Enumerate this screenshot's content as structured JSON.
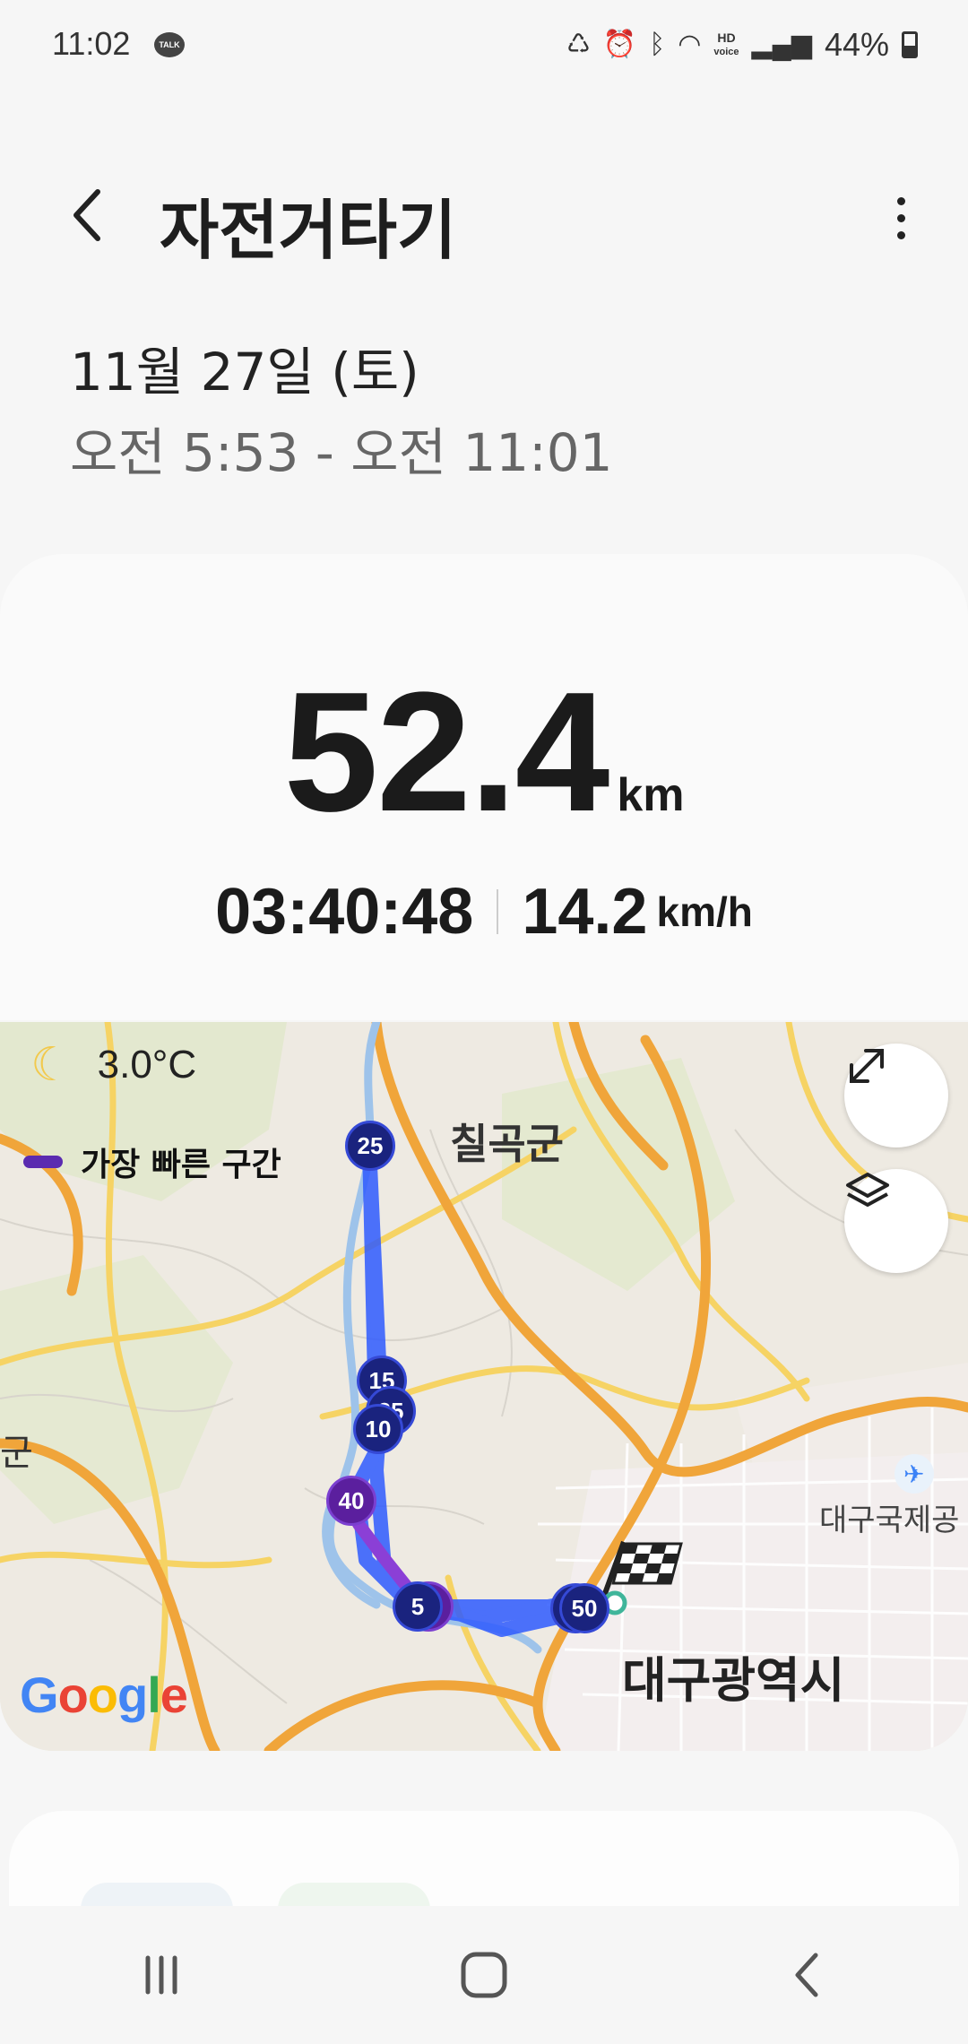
{
  "status_bar": {
    "time": "11:02",
    "talk_badge": "TALK",
    "hd_label": "HD",
    "voice_label": "voice",
    "battery": "44%"
  },
  "header": {
    "title": "자전거타기"
  },
  "session": {
    "date": "11월 27일 (토)",
    "time_range": "오전 5:53 - 오전 11:01"
  },
  "stats": {
    "distance": "52.4",
    "distance_unit": "km",
    "duration": "03:40:48",
    "avg_speed": "14.2",
    "speed_unit": "km/h"
  },
  "map": {
    "temperature": "3.0°C",
    "legend_label": "가장 빠른 구간",
    "place_chilgok": "칠곡군",
    "place_daegu": "대구광역시",
    "place_airport": "대구국제공",
    "place_gun_left": "군",
    "google": [
      "G",
      "o",
      "o",
      "g",
      "l",
      "e"
    ],
    "markers": [
      "25",
      "15",
      "35",
      "10",
      "40",
      "5",
      "50"
    ],
    "route_color": "#2f5bff",
    "fast_segment_color": "#6a1fb5"
  }
}
